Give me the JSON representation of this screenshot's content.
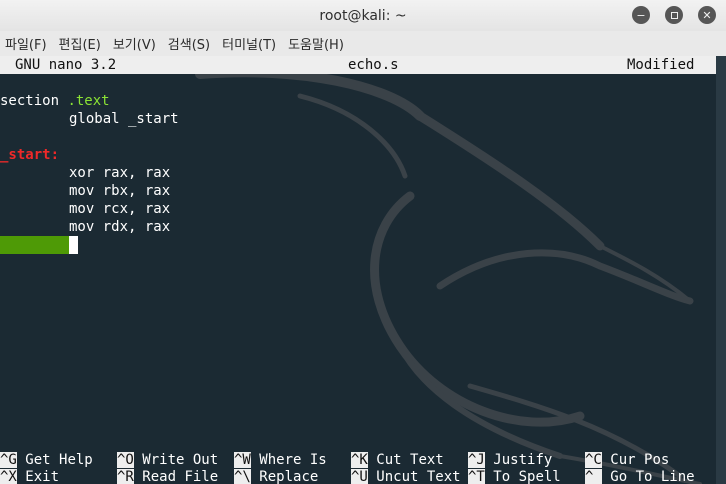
{
  "window": {
    "title": "root@kali: ~"
  },
  "menu": [
    "파일(F)",
    "편집(E)",
    "보기(V)",
    "검색(S)",
    "터미널(T)",
    "도움말(H)"
  ],
  "nano": {
    "version": "GNU nano 3.2",
    "filename": "echo.s",
    "status": "Modified"
  },
  "code": {
    "l1_directive": "section",
    "l1_arg": ".text",
    "l2": "global _start",
    "l4_label": "_start:",
    "l5": "xor rax, rax",
    "l6": "mov rbx, rax",
    "l7": "mov rcx, rax",
    "l8": "mov rdx, rax"
  },
  "shortcuts": {
    "row1": [
      {
        "key": "^G",
        "label": "Get Help"
      },
      {
        "key": "^O",
        "label": "Write Out"
      },
      {
        "key": "^W",
        "label": "Where Is"
      },
      {
        "key": "^K",
        "label": "Cut Text"
      },
      {
        "key": "^J",
        "label": "Justify"
      },
      {
        "key": "^C",
        "label": "Cur Pos"
      }
    ],
    "row2": [
      {
        "key": "^X",
        "label": "Exit"
      },
      {
        "key": "^R",
        "label": "Read File"
      },
      {
        "key": "^\\",
        "label": "Replace"
      },
      {
        "key": "^U",
        "label": "Uncut Text"
      },
      {
        "key": "^T",
        "label": "To Spell"
      },
      {
        "key": "^_",
        "label": "Go To Line"
      }
    ]
  }
}
